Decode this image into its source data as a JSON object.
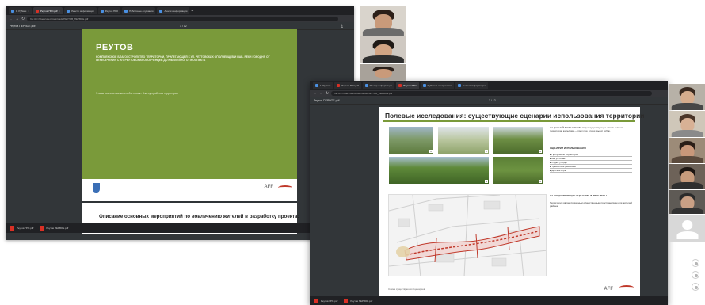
{
  "window_back": {
    "tabs": [
      {
        "label": "1. Рубики"
      },
      {
        "label": "Реутов ПГО.pdf"
      },
      {
        "label": "Реестр информации"
      },
      {
        "label": "Реутов ПГО"
      },
      {
        "label": "Публичные слушания"
      },
      {
        "label": "Анализ информации"
      }
    ],
    "url": "file:///C:/Users/user/Downloads/РЕУТОВ_ПЕРВОЕ.pdf",
    "pdf_title": "Реутов ПЕРВОЕ.pdf",
    "page_indicator": "1 / 12",
    "slide": {
      "title": "РЕУТОВ",
      "subtitle": "КОМПЛЕКСНОЕ БЛАГОУСТРОЙСТВО ТЕРРИТОРИИ, ПРИЛЕГАЮЩЕЙ К УЛ. РЕУТОВСКИХ ОПОЛЧЕНЦЕВ И НАБ. РЕКИ ГОРОДНЯ ОТ ПЕРЕСЕЧЕНИЯ С УЛ. РЕУТОВСКИХ ОПОЛЧЕНЦЕВ ДО ЮБИЛЕЙНОГО ПРОСПЕКТА",
      "description": "Этапы вовлечения жителей в проект благоустройства территории",
      "logo_text": "AFF",
      "next_slide_text": "Описание основных мероприятий по вовлечению жителей в разработку проекта:"
    },
    "downloads": [
      "Реутов ПГО.pdf",
      "Реутов ПЕРВОЕ.pdf"
    ]
  },
  "window_front": {
    "pdf_title": "Реутов ПЕРВОЕ.pdf",
    "page_indicator": "3 / 12",
    "slide": {
      "heading": "Полевые исследования: существующие сценарии использования территории",
      "text_block_1": "НА ДАННОЙ ФОТО-ГРАФИИ видно существующее использование территории жителями — прогулки, отдых, выгул собак.",
      "scenarios_title": "СЦЕНАРИИ ИСПОЛЬЗОВАНИЯ",
      "scenarios": [
        "Прогулки по территории",
        "Выгул собак",
        "Отдых у воды",
        "Транзитное движение",
        "Детские игры"
      ],
      "text_block_2_title": "НА СУЩЕСТВУЮЩИЕ СЦЕНАРИИ И ПРОБЛЕМЫ",
      "text_block_2": "Территория является важным общественным пространством для жителей района.",
      "caption": "Схема существующих сценариев",
      "logo_text": "AFF"
    },
    "downloads": [
      "Реутов ПГО.pdf",
      "Реутов ПЕРВОЕ.pdf"
    ]
  },
  "participants_count": 9,
  "colors": {
    "slide_green": "#7a9a3a",
    "viewer_dark": "#323639",
    "tabbar": "#202124",
    "route_red": "#c0392b"
  }
}
